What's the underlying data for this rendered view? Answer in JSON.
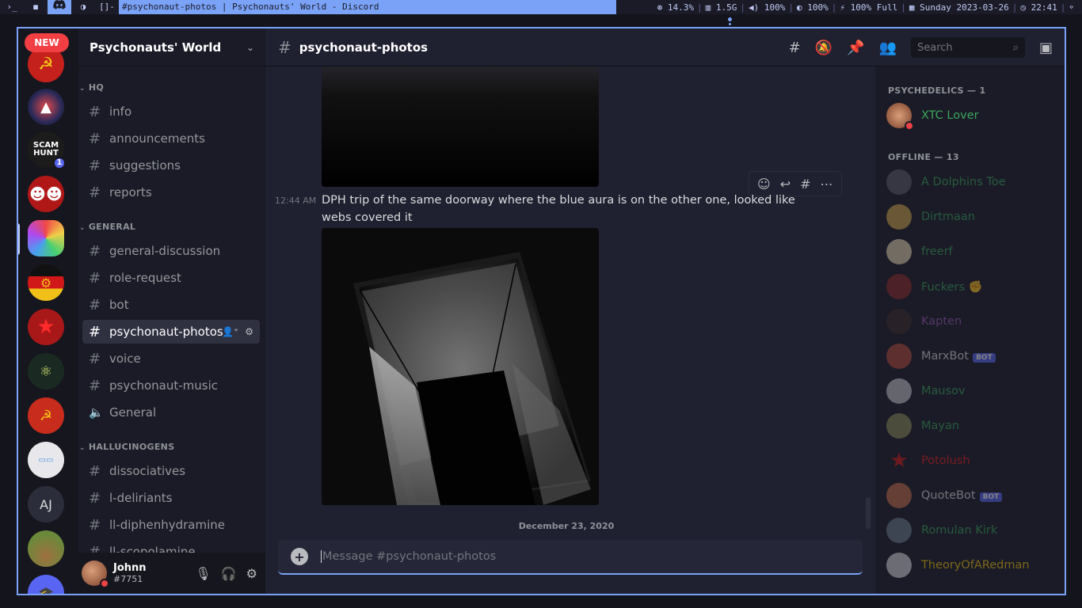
{
  "topbar": {
    "icons": [
      "›_",
      "◼",
      "discord",
      "◑",
      "[]-"
    ],
    "window_title": "#psychonaut-photos | Psychonauts' World - Discord",
    "stats": [
      "14.3%",
      "1.5G",
      "100%",
      "100%",
      "100% Full",
      "Sunday 2023-03-26",
      "22:41"
    ]
  },
  "servers": {
    "new_label": "NEW",
    "badge_count": "1",
    "initials_label": "AJ",
    "colors": [
      "#c4201c",
      "#2a2a5a",
      "#1c1c1c",
      "#b01818",
      "#e8e8f0",
      "#d0a020",
      "#a81818",
      "#1a2a22",
      "#c82c1c",
      "#e8e8ec",
      "#2b2d3a",
      "#6a8a3a",
      "#5865f2"
    ]
  },
  "guild": {
    "name": "Psychonauts' World"
  },
  "channels": {
    "categories": [
      {
        "label": "HQ"
      },
      {
        "label": "GENERAL"
      },
      {
        "label": "HALLUCINOGENS"
      }
    ],
    "hq": [
      "info",
      "announcements",
      "suggestions",
      "reports"
    ],
    "general": [
      "general-discussion",
      "role-request",
      "bot",
      "psychonaut-photos",
      "voice",
      "psychonaut-music",
      "General"
    ],
    "hallucinogens": [
      "dissociatives",
      "l-deliriants",
      "ll-diphenhydramine",
      "ll-scopolamine"
    ]
  },
  "user": {
    "name": "Johnn",
    "tag": "#7751"
  },
  "chat": {
    "channel_name": "psychonaut-photos",
    "search_placeholder": "Search",
    "message_time": "12:44 AM",
    "message_text": "DPH trip of the same doorway where the blue aura is on the other one, looked like webs covered it",
    "date_divider": "December 23, 2020",
    "composer_placeholder": "Message #psychonaut-photos"
  },
  "members": {
    "online_header": "PSYCHEDELICS — 1",
    "offline_header": "OFFLINE — 13",
    "online": [
      {
        "name": "XTC Lover",
        "color": "#3ba55d"
      }
    ],
    "offline": [
      {
        "name": "A Dolphins Toe",
        "color": "#3ba55d"
      },
      {
        "name": "Dirtmaan",
        "color": "#3ba55d"
      },
      {
        "name": "freerf",
        "color": "#3ba55d"
      },
      {
        "name": "Fuckers",
        "color": "#3ba55d"
      },
      {
        "name": "Kapten",
        "color": "#9b59b6"
      },
      {
        "name": "MarxBot",
        "color": "#8e9297",
        "bot": "BOT"
      },
      {
        "name": "Mausov",
        "color": "#3ba55d"
      },
      {
        "name": "Mayan",
        "color": "#3ba55d"
      },
      {
        "name": "Potolush",
        "color": "#e91e1e"
      },
      {
        "name": "QuoteBot",
        "color": "#8e9297",
        "bot": "BOT"
      },
      {
        "name": "Romulan Kirk",
        "color": "#3ba55d"
      },
      {
        "name": "TheoryOfARedman",
        "color": "#f1c40f"
      }
    ]
  }
}
